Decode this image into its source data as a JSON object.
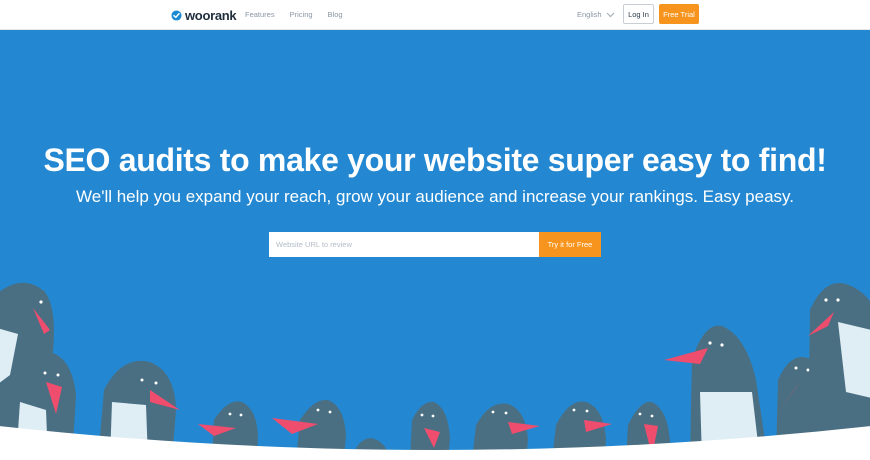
{
  "brand": {
    "name": "woorank"
  },
  "nav": {
    "items": [
      "Features",
      "Pricing",
      "Blog"
    ]
  },
  "language": {
    "selected": "English",
    "icon": "chevron-down-icon"
  },
  "auth": {
    "login_label": "Log In",
    "trial_label": "Free Trial"
  },
  "hero": {
    "headline": "SEO audits to make your website super easy to find!",
    "subline": "We'll help you expand your reach, grow your audience and increase your rankings. Easy peasy.",
    "input_placeholder": "Website URL to review",
    "cta_label": "Try it for Free"
  },
  "colors": {
    "hero_bg": "#2388d1",
    "accent": "#f7941d",
    "penguin_body": "#4b6f82",
    "penguin_belly": "#dfeef5",
    "penguin_beak": "#ee4d6e"
  }
}
